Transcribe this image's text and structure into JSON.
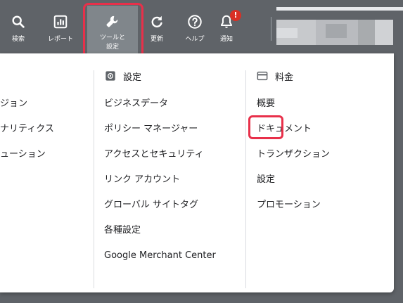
{
  "topbar": {
    "search_label": "検索",
    "reports_label": "レポート",
    "tools_label": "ツールと\n設定",
    "refresh_label": "更新",
    "help_label": "ヘルプ",
    "notifications_label": "通知",
    "notifications_badge": "!"
  },
  "menu": {
    "column1": {
      "items": [
        "ジョン",
        "ナリティクス",
        "ューション"
      ]
    },
    "column2": {
      "heading": "設定",
      "items": [
        "ビジネスデータ",
        "ポリシー マネージャー",
        "アクセスとセキュリティ",
        "リンク アカウント",
        "グローバル サイトタグ",
        "各種設定",
        "Google Merchant Center"
      ]
    },
    "column3": {
      "heading": "料金",
      "items": [
        "概要",
        "ドキュメント",
        "トランザクション",
        "設定",
        "プロモーション"
      ]
    }
  },
  "colors": {
    "topbar_bg": "#5f6368",
    "tools_active_bg": "#80868b",
    "highlight_border": "#e8304a",
    "badge_red": "#d93025",
    "text_primary": "#202124"
  }
}
